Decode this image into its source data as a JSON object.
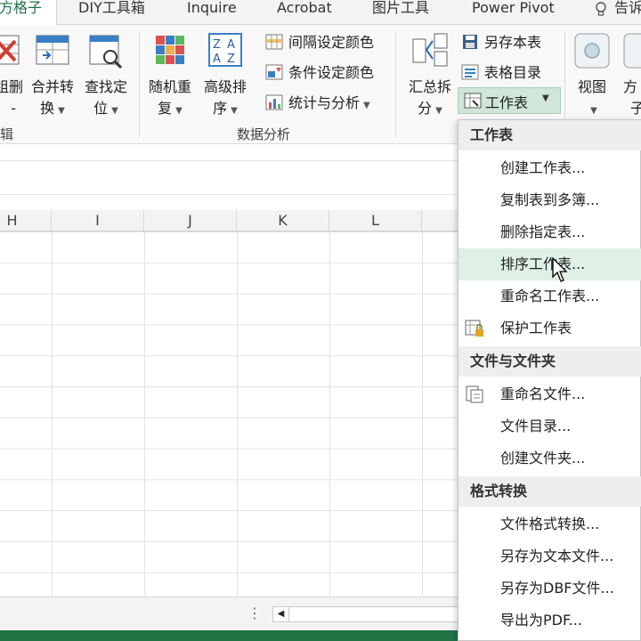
{
  "tabs": [
    {
      "label": "方格子",
      "active": true
    },
    {
      "label": "DIY工具箱"
    },
    {
      "label": "Inquire"
    },
    {
      "label": "Acrobat"
    },
    {
      "label": "图片工具"
    },
    {
      "label": "Power Pivot"
    },
    {
      "label": "告诉"
    }
  ],
  "ribbon": {
    "edit_group": {
      "partial_label": "辑",
      "batch_delete": {
        "line1": "组删",
        "line2": "-"
      },
      "merge_convert": {
        "line1": "合并转",
        "line2": "换"
      },
      "find_locate": {
        "line1": "查找定",
        "line2": "位"
      }
    },
    "data_analysis": {
      "label": "数据分析",
      "random_repeat": {
        "line1": "随机重",
        "line2": "复"
      },
      "advanced_sort": {
        "line1": "高级排",
        "line2": "序"
      },
      "interval_color": "间隔设定颜色",
      "condition_color": "条件设定颜色",
      "stats_analysis": "统计与分析"
    },
    "sheet_group": {
      "summary_split": {
        "line1": "汇总拆",
        "line2": "分"
      },
      "save_sheet": "另存本表",
      "sheet_directory": "表格目录",
      "worksheet": "工作表"
    },
    "view": {
      "label": "视图"
    },
    "partial_right": {
      "line1": "方",
      "line2": "子"
    }
  },
  "columns": [
    "H",
    "I",
    "J",
    "K",
    "L"
  ],
  "colors": {
    "accent": "#217346",
    "hover": "#dff0e6",
    "selected_button": "#cfe6d8"
  },
  "menu": {
    "sections": [
      {
        "header": "工作表",
        "items": [
          {
            "label": "创建工作表..."
          },
          {
            "label": "复制表到多簿..."
          },
          {
            "label": "删除指定表..."
          },
          {
            "label": "排序工作表...",
            "hovered": true
          },
          {
            "label": "重命名工作表..."
          },
          {
            "label": "保护工作表",
            "icon": "protect-sheet-icon"
          }
        ]
      },
      {
        "header": "文件与文件夹",
        "items": [
          {
            "label": "重命名文件...",
            "icon": "rename-file-icon"
          },
          {
            "label": "文件目录..."
          },
          {
            "label": "创建文件夹..."
          }
        ]
      },
      {
        "header": "格式转换",
        "items": [
          {
            "label": "文件格式转换..."
          },
          {
            "label": "另存为文本文件..."
          },
          {
            "label": "另存为DBF文件..."
          },
          {
            "label": "导出为PDF..."
          }
        ]
      }
    ]
  }
}
